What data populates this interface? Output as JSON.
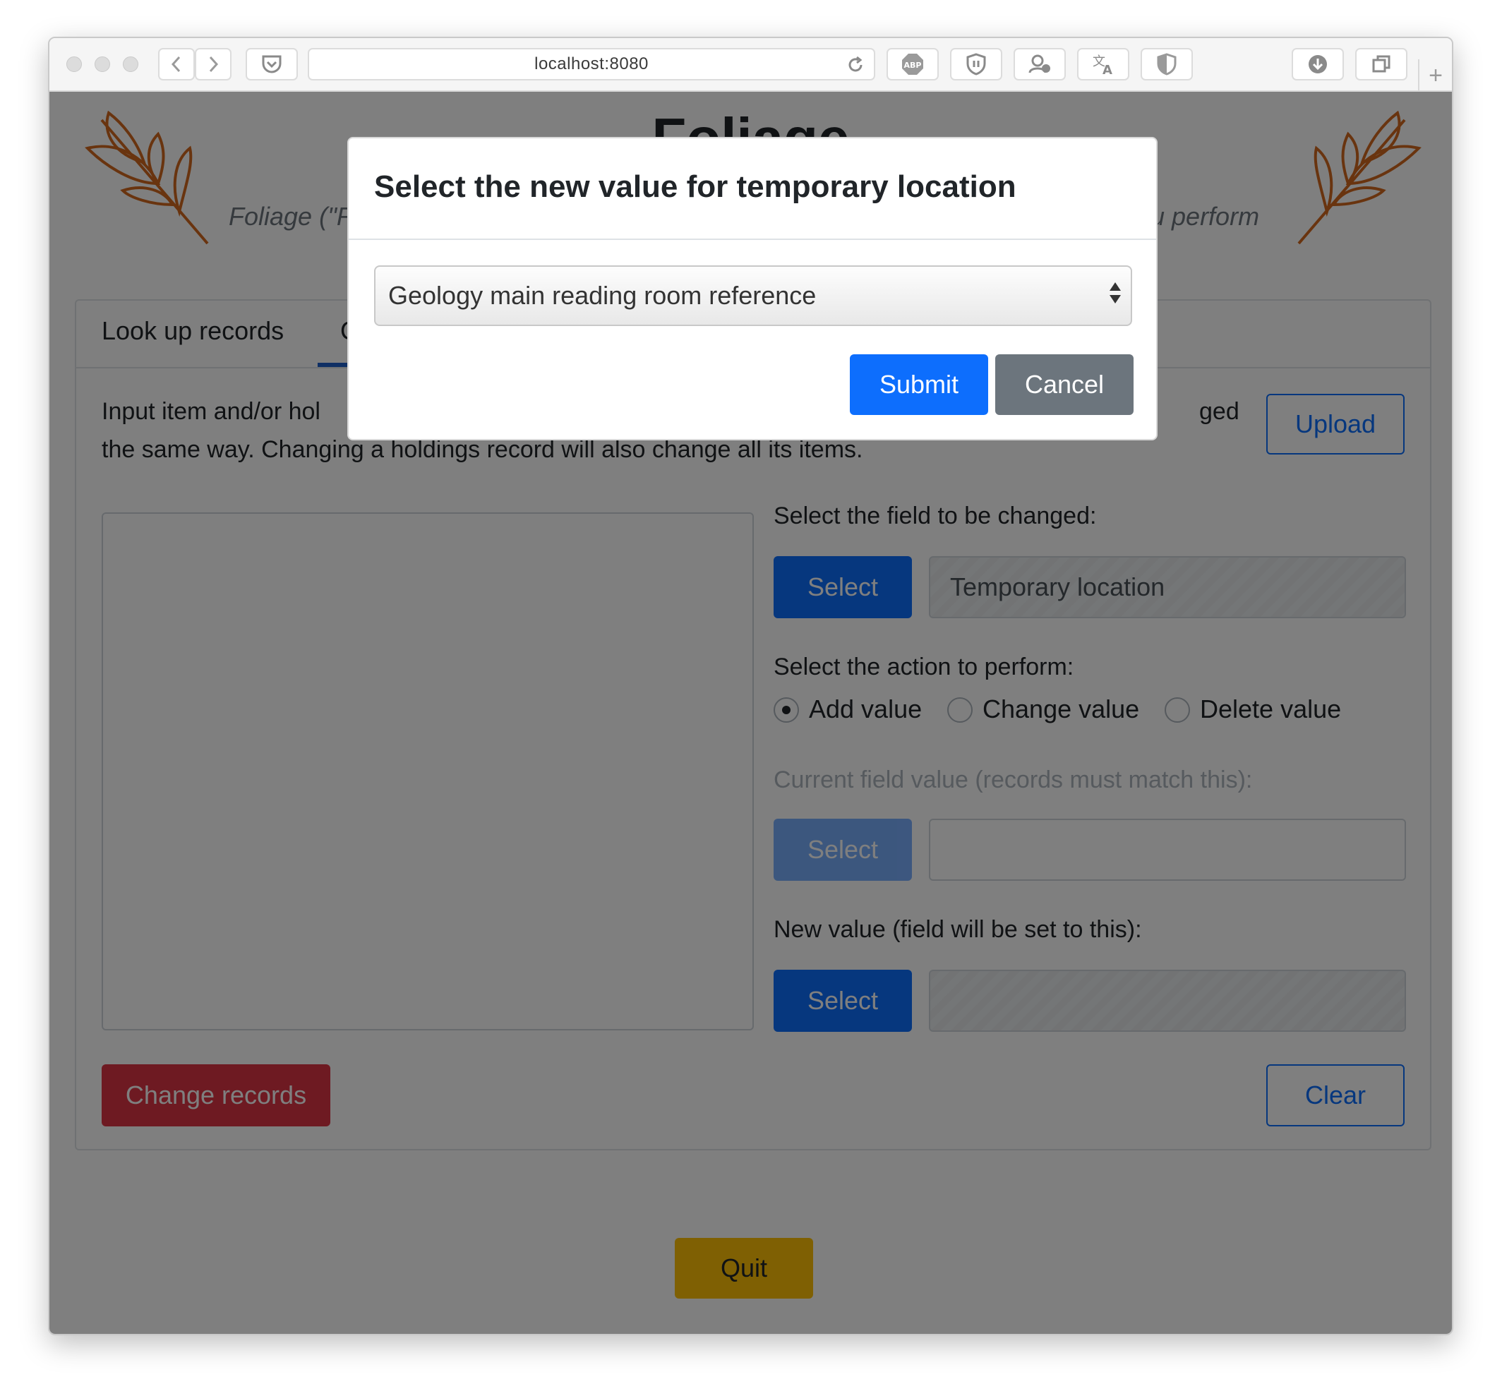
{
  "browser": {
    "url": "localhost:8080"
  },
  "header": {
    "title": "Foliage",
    "subtitle_left": "Foliage (\"F",
    "subtitle_right": "u perform"
  },
  "tabs": [
    {
      "label": "Look up records"
    },
    {
      "label": "C"
    }
  ],
  "change_panel": {
    "intro_line1_left": "Input item and/or hol",
    "intro_line1_right": "ged",
    "intro_line2": "the same way. Changing a holdings record will also change all its items.",
    "upload_label": "Upload",
    "field_label": "Select the field to be changed:",
    "field_select_label": "Select",
    "field_value": "Temporary location",
    "action_label": "Select the action to perform:",
    "actions": [
      {
        "label": "Add value",
        "checked": true
      },
      {
        "label": "Change value",
        "checked": false
      },
      {
        "label": "Delete value",
        "checked": false
      }
    ],
    "current_label": "Current field value (records must match this):",
    "current_select_label": "Select",
    "new_label": "New value (field will be set to this):",
    "new_select_label": "Select",
    "change_records_label": "Change records",
    "clear_label": "Clear"
  },
  "quit_label": "Quit",
  "modal": {
    "title": "Select the new value for temporary location",
    "selected_option": "Geology main reading room reference",
    "submit_label": "Submit",
    "cancel_label": "Cancel"
  },
  "colors": {
    "primary": "#0d6efd",
    "danger": "#dc3545",
    "warning": "#ffc107",
    "secondary": "#6c757d",
    "leaf": "#d2691e"
  }
}
